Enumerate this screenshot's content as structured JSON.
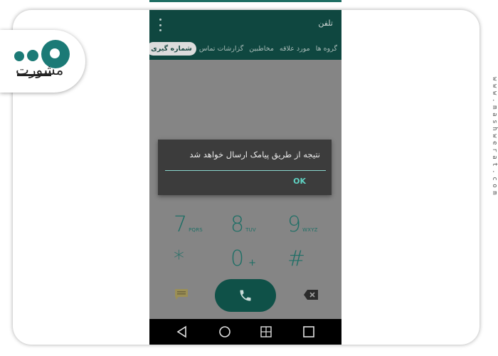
{
  "branding": {
    "logo_text": "مشورت",
    "watermark": "www.mashwerat.com",
    "accent_color": "#1b7a76"
  },
  "app_bar": {
    "title": "تلفن",
    "menu_icon": "overflow-menu-icon"
  },
  "tabs": [
    {
      "label": "گروه ها",
      "active": false
    },
    {
      "label": "مورد علاقه",
      "active": false
    },
    {
      "label": "مخاطبین",
      "active": false
    },
    {
      "label": "گزارشات تماس",
      "active": false
    },
    {
      "label": "شماره گیری",
      "active": true
    }
  ],
  "dialog": {
    "message": "نتیجه از طریق پیامک ارسال خواهد شد",
    "ok_label": "OK"
  },
  "keypad": {
    "keys": [
      {
        "digit": "7",
        "letters": "PQRS"
      },
      {
        "digit": "8",
        "letters": "TUV"
      },
      {
        "digit": "9",
        "letters": "WXYZ"
      },
      {
        "digit": "*",
        "letters": ""
      },
      {
        "digit": "0",
        "letters": "+"
      },
      {
        "digit": "#",
        "letters": ""
      }
    ],
    "left_action_icon": "sms-icon",
    "call_icon": "phone-icon",
    "right_action_icon": "backspace-icon"
  },
  "nav_bar": {
    "buttons": [
      "back-icon",
      "home-icon",
      "recents-icon",
      "square-icon"
    ]
  },
  "colors": {
    "app_bar": "#0f4740",
    "dimmed_background": "#858585",
    "keypad_text": "#1f6f66",
    "call_button": "#0f5148",
    "dialog_background": "#3c3c3c",
    "dialog_accent": "#5fd3c3"
  }
}
